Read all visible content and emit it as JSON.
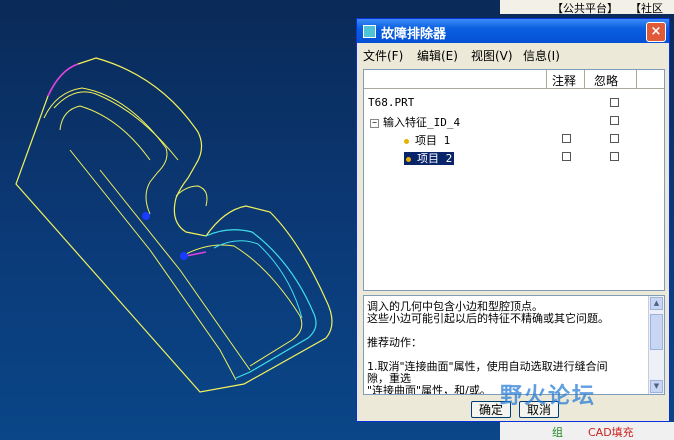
{
  "window": {
    "title": "故障排除器",
    "close_glyph": "×"
  },
  "menu": {
    "items": [
      {
        "label": "文件(F)"
      },
      {
        "label": "编辑(E)"
      },
      {
        "label": "视图(V)"
      },
      {
        "label": "信息(I)"
      }
    ]
  },
  "tree": {
    "columns": {
      "annotate": "注释",
      "ignore": "忽略"
    },
    "rows": [
      {
        "label": "T68.PRT"
      },
      {
        "label": "输入特征_ID_4",
        "expander": "−"
      },
      {
        "label": "项目 1"
      },
      {
        "label": "项目 2",
        "selected": true
      }
    ]
  },
  "message": {
    "lines": [
      "调入的几何中包含小边和型腔顶点。",
      "这些小边可能引起以后的特征不精确或其它问题。",
      "",
      "推荐动作：",
      "",
      "1.取消\"连接曲面\"属性，使用自动选取进行缝合间",
      "隙，重选",
      "\"连接曲面\"属性，和/或。"
    ]
  },
  "buttons": {
    "ok": "确定",
    "cancel": "取消"
  },
  "background": {
    "top_strip": [
      "【公共平台】",
      "【社区"
    ],
    "bottom_strip": [
      "组",
      "CAD填充"
    ]
  },
  "watermark": "野火论坛",
  "colors": {
    "viewport": "#0b3a78",
    "titlebar": "#0550d5",
    "curve_yellow": "#f2f25a",
    "curve_cyan": "#40e0e8",
    "curve_magenta": "#e040e0"
  }
}
